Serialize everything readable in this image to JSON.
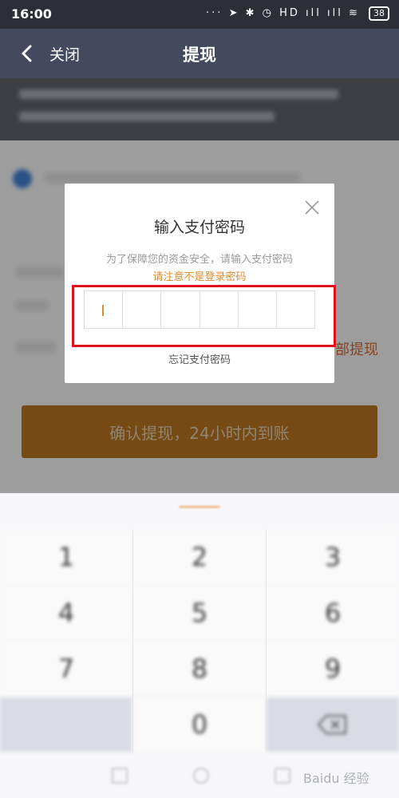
{
  "status_bar": {
    "time": "16:00",
    "signal_icons": "··· ➤ ✱ ◷ HD ıll ıll ≋",
    "battery": "38"
  },
  "nav": {
    "back_icon": "chevron-left-icon",
    "close_label": "关闭",
    "title": "提现"
  },
  "background": {
    "all_withdraw_label": "部提现",
    "confirm_button_label": "确认提现，24小时内到账"
  },
  "dialog": {
    "title": "输入支付密码",
    "hint": "为了保障您的资金安全，请输入支付密码",
    "warning": "请注意不是登录密码",
    "pin_length": 6,
    "forgot_label": "忘记支付密码"
  },
  "keypad": {
    "keys": [
      "1",
      "2",
      "3",
      "4",
      "5",
      "6",
      "7",
      "8",
      "9",
      "",
      "0",
      ""
    ]
  },
  "watermark": "Baidu 经验",
  "colors": {
    "accent": "#e08a2c",
    "nav_bg": "#434a5e",
    "highlight_frame": "#e0121b"
  }
}
